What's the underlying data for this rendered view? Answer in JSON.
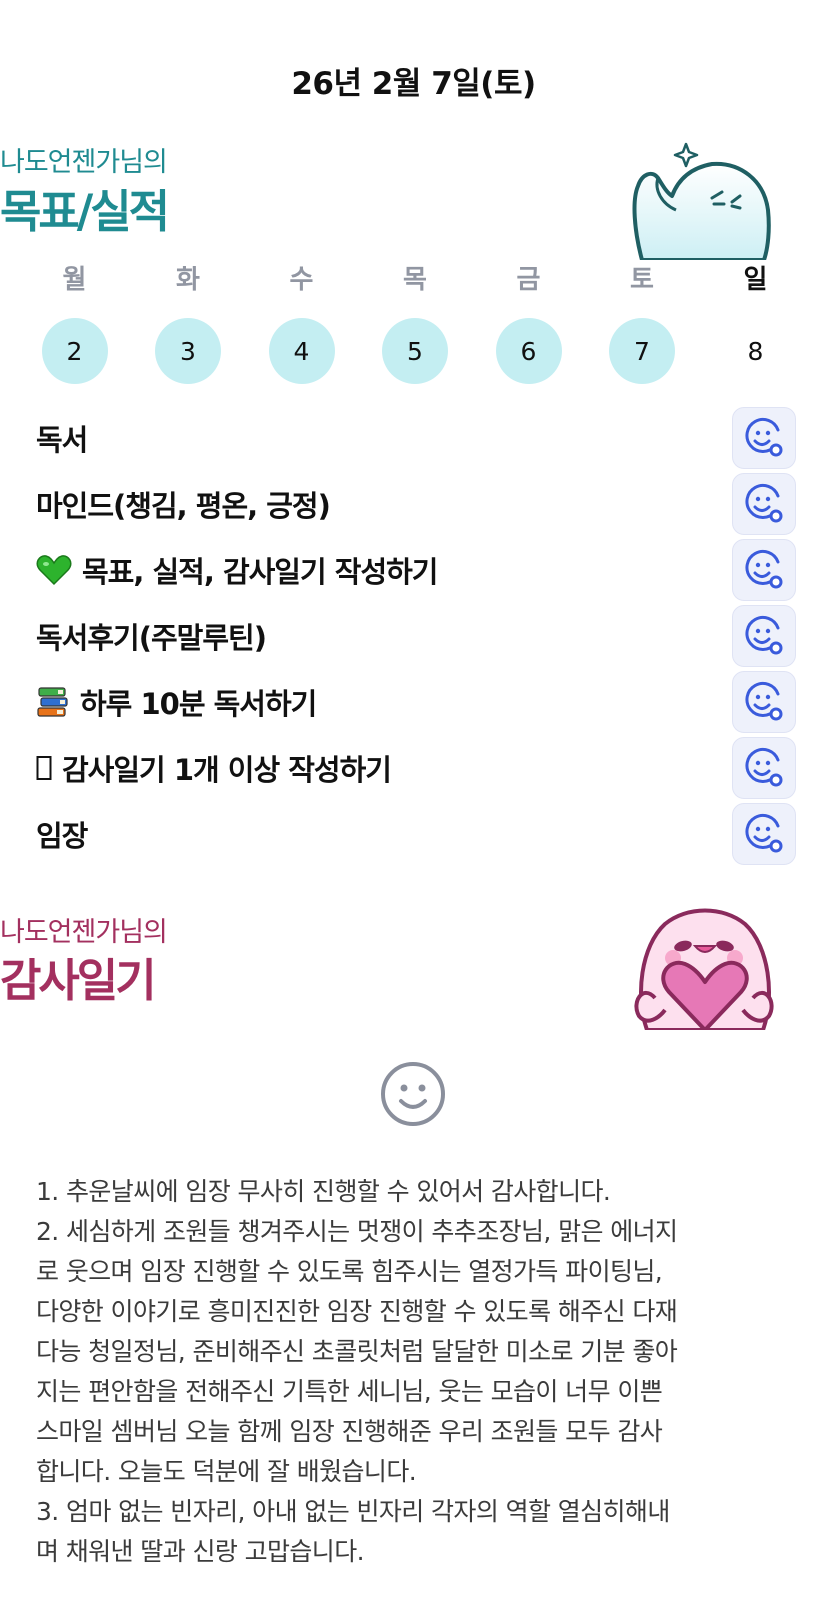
{
  "header": {
    "date": "26년 2월 7일(토)"
  },
  "goals_section": {
    "owner": "나도언젠가님의",
    "title": "목표/실적"
  },
  "week": {
    "days": [
      {
        "dow": "월",
        "date": "2",
        "done": true,
        "today": false
      },
      {
        "dow": "화",
        "date": "3",
        "done": true,
        "today": false
      },
      {
        "dow": "수",
        "date": "4",
        "done": true,
        "today": false
      },
      {
        "dow": "목",
        "date": "5",
        "done": true,
        "today": false
      },
      {
        "dow": "금",
        "date": "6",
        "done": true,
        "today": false
      },
      {
        "dow": "토",
        "date": "7",
        "done": true,
        "today": false
      },
      {
        "dow": "일",
        "date": "8",
        "done": false,
        "today": true
      }
    ]
  },
  "goals": [
    {
      "label": "독서",
      "icon": ""
    },
    {
      "label": "마인드(챙김, 평온, 긍정)",
      "icon": ""
    },
    {
      "label": "목표, 실적, 감사일기 작성하기",
      "icon": "green-heart-icon"
    },
    {
      "label": "독서후기(주말루틴)",
      "icon": ""
    },
    {
      "label": "하루 10분 독서하기",
      "icon": "books-icon"
    },
    {
      "label": "감사일기 1개 이상 작성하기",
      "icon": "missing-glyph-icon"
    },
    {
      "label": "임장",
      "icon": ""
    }
  ],
  "gratitude_section": {
    "owner": "나도언젠가님의",
    "title": "감사일기"
  },
  "journal": {
    "lines": [
      "1. 추운날씨에 임장 무사히 진행할 수 있어서 감사합니다.",
      "2. 세심하게 조원들 챙겨주시는 멋쟁이 추추조장님, 맑은 에너지",
      "로 웃으며 임장 진행할 수 있도록 힘주시는 열정가득 파이팅님,",
      "다양한 이야기로 흥미진진한 임장 진행할 수 있도록 해주신 다재",
      "다능 청일정님, 준비해주신 초콜릿처럼 달달한 미소로 기분 좋아",
      "지는 편안함을 전해주신 기특한 세니님, 웃는 모습이 너무 이쁜",
      "스마일 셈버님 오늘 함께 임장 진행해준 우리 조원들 모두 감사",
      "합니다. 오늘도 덕분에 잘 배웠습니다.",
      "3. 엄마 없는 빈자리, 아내 없는 빈자리 각자의 역할 열심히해내",
      "며 채워낸 딸과 신랑 고맙습니다."
    ]
  },
  "colors": {
    "teal_title": "#1f8b91",
    "plum_title": "#a3305f",
    "date_done_bg": "#c4eef2",
    "reaction_icon": "#3a5bdc"
  }
}
